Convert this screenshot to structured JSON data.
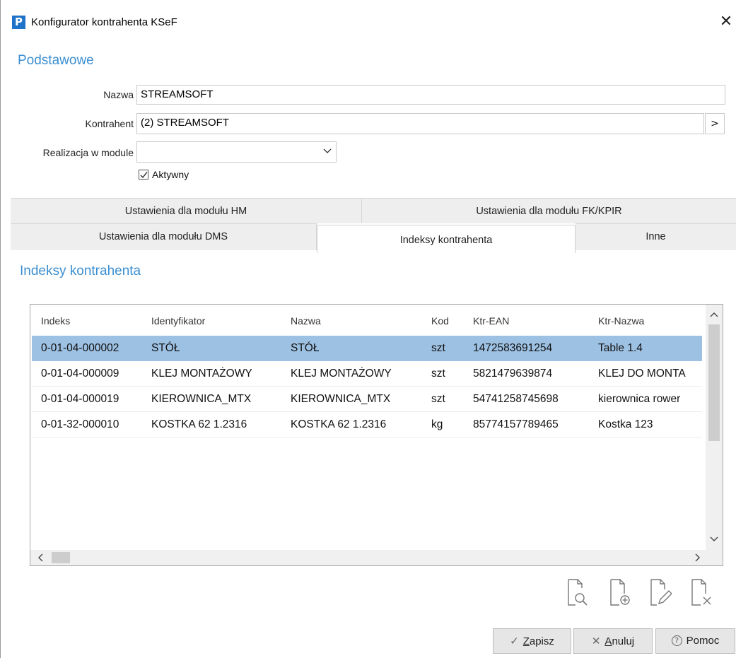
{
  "window": {
    "title": "Konfigurator kontrahenta KSeF",
    "logo": "P",
    "close_symbol": "✕"
  },
  "basic": {
    "section_title": "Podstawowe",
    "nazwa_label": "Nazwa",
    "nazwa_value": "STREAMSOFT",
    "kontrahent_label": "Kontrahent",
    "kontrahent_value": "(2) STREAMSOFT",
    "kontrahent_button": ">",
    "realizacja_label": "Realizacja w module",
    "realizacja_value": "",
    "aktywny_label": "Aktywny",
    "aktywny_checked": true
  },
  "tabs": {
    "hm": "Ustawienia dla modułu HM",
    "fk": "Ustawienia dla modułu FK/KPIR",
    "dms": "Ustawienia dla modułu DMS",
    "indeksy": "Indeksy kontrahenta",
    "inne": "Inne",
    "active": "indeksy"
  },
  "indeksy": {
    "section_title": "Indeksy kontrahenta",
    "columns": [
      "Indeks",
      "Identyfikator",
      "Nazwa",
      "Kod",
      "Ktr-EAN",
      "Ktr-Nazwa"
    ],
    "rows": [
      [
        "0-01-04-000002",
        "STÓŁ",
        "STÓŁ",
        "szt",
        "1472583691254",
        "Table 1.4"
      ],
      [
        "0-01-04-000009",
        "KLEJ MONTAŻOWY",
        "KLEJ MONTAŻOWY",
        "szt",
        "5821479639874",
        "KLEJ DO MONTA"
      ],
      [
        "0-01-04-000019",
        "KIEROWNICA_MTX",
        "KIEROWNICA_MTX",
        "szt",
        "54741258745698",
        "kierownica rower"
      ],
      [
        "0-01-32-000010",
        "KOSTKA 62 1.2316",
        "KOSTKA 62 1.2316",
        "kg",
        "85774157789465",
        "Kostka 123"
      ]
    ],
    "selected_row": 0,
    "toolbar_icons": [
      "preview-document-icon",
      "add-document-icon",
      "edit-document-icon",
      "delete-document-icon"
    ]
  },
  "footer": {
    "zapisz_icon": "✓",
    "zapisz_u": "Z",
    "zapisz_rest": "apisz",
    "anuluj_icon": "✕",
    "anuluj_u": "A",
    "anuluj_rest": "nuluj",
    "pomoc_icon": "?",
    "pomoc_label": "Pomoc"
  }
}
